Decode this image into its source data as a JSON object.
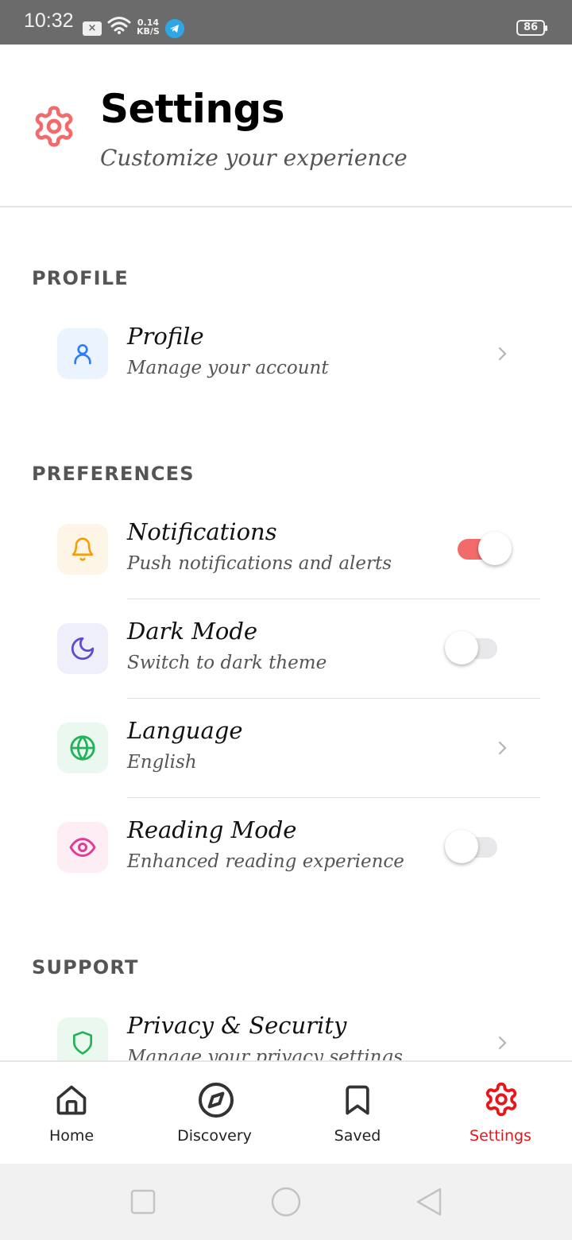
{
  "status_bar": {
    "time": "10:32",
    "speed_value": "0.14",
    "speed_unit": "KB/S",
    "battery": "86"
  },
  "header": {
    "icon": "gear-icon",
    "title": "Settings",
    "subtitle": "Customize your experience"
  },
  "sections": {
    "profile": {
      "title": "PROFILE",
      "items": [
        {
          "icon": "user-icon",
          "title": "Profile",
          "subtitle": "Manage your account",
          "control": "chevron"
        }
      ]
    },
    "preferences": {
      "title": "PREFERENCES",
      "items": [
        {
          "icon": "bell-icon",
          "title": "Notifications",
          "subtitle": "Push notifications and alerts",
          "control": "toggle",
          "on": true
        },
        {
          "icon": "moon-icon",
          "title": "Dark Mode",
          "subtitle": "Switch to dark theme",
          "control": "toggle",
          "on": false
        },
        {
          "icon": "globe-icon",
          "title": "Language",
          "subtitle": "English",
          "control": "chevron"
        },
        {
          "icon": "eye-icon",
          "title": "Reading Mode",
          "subtitle": "Enhanced reading experience",
          "control": "toggle",
          "on": false
        }
      ]
    },
    "support": {
      "title": "SUPPORT",
      "items": [
        {
          "icon": "shield-icon",
          "title": "Privacy & Security",
          "subtitle": "Manage your privacy settings",
          "control": "chevron"
        }
      ]
    }
  },
  "bottom_nav": {
    "items": [
      {
        "icon": "home-icon",
        "label": "Home"
      },
      {
        "icon": "compass-icon",
        "label": "Discovery"
      },
      {
        "icon": "bookmark-icon",
        "label": "Saved"
      },
      {
        "icon": "gear-icon",
        "label": "Settings",
        "active": true
      }
    ]
  },
  "colors": {
    "accent": "#f36a6a",
    "active_nav": "#e8151b",
    "user": "#2f7df6",
    "bell": "#f59e0b",
    "moon": "#5b4fcf",
    "globe": "#22b35a",
    "eye": "#e23d96",
    "shield": "#22b35a"
  }
}
